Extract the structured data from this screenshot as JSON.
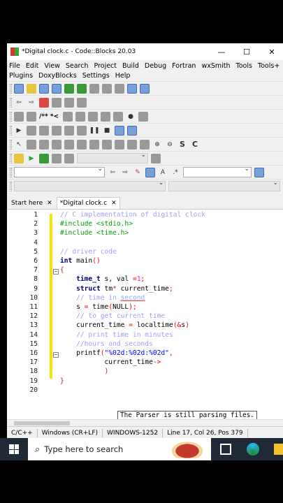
{
  "window": {
    "title": "*Digital clock.c - Code::Blocks 20.03"
  },
  "menu": {
    "row1": [
      "File",
      "Edit",
      "View",
      "Search",
      "Project",
      "Build",
      "Debug",
      "Fortran",
      "wxSmith",
      "Tools",
      "Tools+"
    ],
    "row2": [
      "Plugins",
      "DoxyBlocks",
      "Settings",
      "Help"
    ]
  },
  "toolbar": {
    "comment_label": "/** *<"
  },
  "tabs": [
    {
      "label": "Start here"
    },
    {
      "label": "*Digital clock.c"
    }
  ],
  "editor": {
    "line_numbers": [
      "1",
      "2",
      "3",
      "4",
      "5",
      "6",
      "7",
      "8",
      "9",
      "10",
      "11",
      "12",
      "13",
      "14",
      "15",
      "16",
      "17",
      "18",
      "19",
      "20"
    ]
  },
  "tooltip": {
    "text": "The Parser is still parsing files."
  },
  "statusbar": {
    "language": "C/C++",
    "eol": "Windows (CR+LF)",
    "encoding": "WINDOWS-1252",
    "position": "Line 17, Col 26, Pos 379"
  },
  "taskbar": {
    "search_placeholder": "Type here to search"
  }
}
